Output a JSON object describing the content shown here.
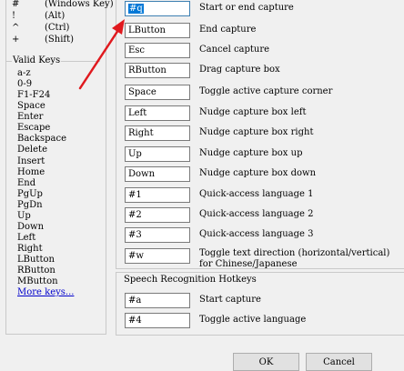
{
  "modifiers": [
    {
      "symbol": "#",
      "desc": "(Windows Key)"
    },
    {
      "symbol": "!",
      "desc": "(Alt)"
    },
    {
      "symbol": "^",
      "desc": "(Ctrl)"
    },
    {
      "symbol": "+",
      "desc": "(Shift)"
    }
  ],
  "valid_keys": {
    "title": "Valid Keys",
    "items": [
      "a-z",
      "0-9",
      "F1-F24",
      "Space",
      "Enter",
      "Escape",
      "Backspace",
      "Delete",
      "Insert",
      "Home",
      "End",
      "PgUp",
      "PgDn",
      "Up",
      "Down",
      "Left",
      "Right",
      "LButton",
      "RButton",
      "MButton"
    ],
    "more_link": "More keys..."
  },
  "hotkeys": [
    {
      "value": "#q",
      "label": "Start or end capture"
    },
    {
      "value": "LButton",
      "label": "End capture"
    },
    {
      "value": "Esc",
      "label": "Cancel capture"
    },
    {
      "value": "RButton",
      "label": "Drag capture box"
    },
    {
      "value": "Space",
      "label": "Toggle active capture corner"
    },
    {
      "value": "Left",
      "label": "Nudge capture box left"
    },
    {
      "value": "Right",
      "label": "Nudge capture box right"
    },
    {
      "value": "Up",
      "label": "Nudge capture box up"
    },
    {
      "value": "Down",
      "label": "Nudge capture box down"
    },
    {
      "value": "#1",
      "label": "Quick-access language 1"
    },
    {
      "value": "#2",
      "label": "Quick-access language 2"
    },
    {
      "value": "#3",
      "label": "Quick-access language 3"
    },
    {
      "value": "#w",
      "label": "Toggle text direction (horizontal/vertical)",
      "label2": "for Chinese/Japanese"
    }
  ],
  "speech": {
    "title": "Speech Recognition Hotkeys",
    "items": [
      {
        "value": "#a",
        "label": "Start capture"
      },
      {
        "value": "#4",
        "label": "Toggle active language"
      }
    ]
  },
  "buttons": {
    "ok": "OK",
    "cancel": "Cancel"
  },
  "colors": {
    "selection": "#0078d7",
    "arrow": "#e0191e",
    "link": "#0000cc"
  }
}
